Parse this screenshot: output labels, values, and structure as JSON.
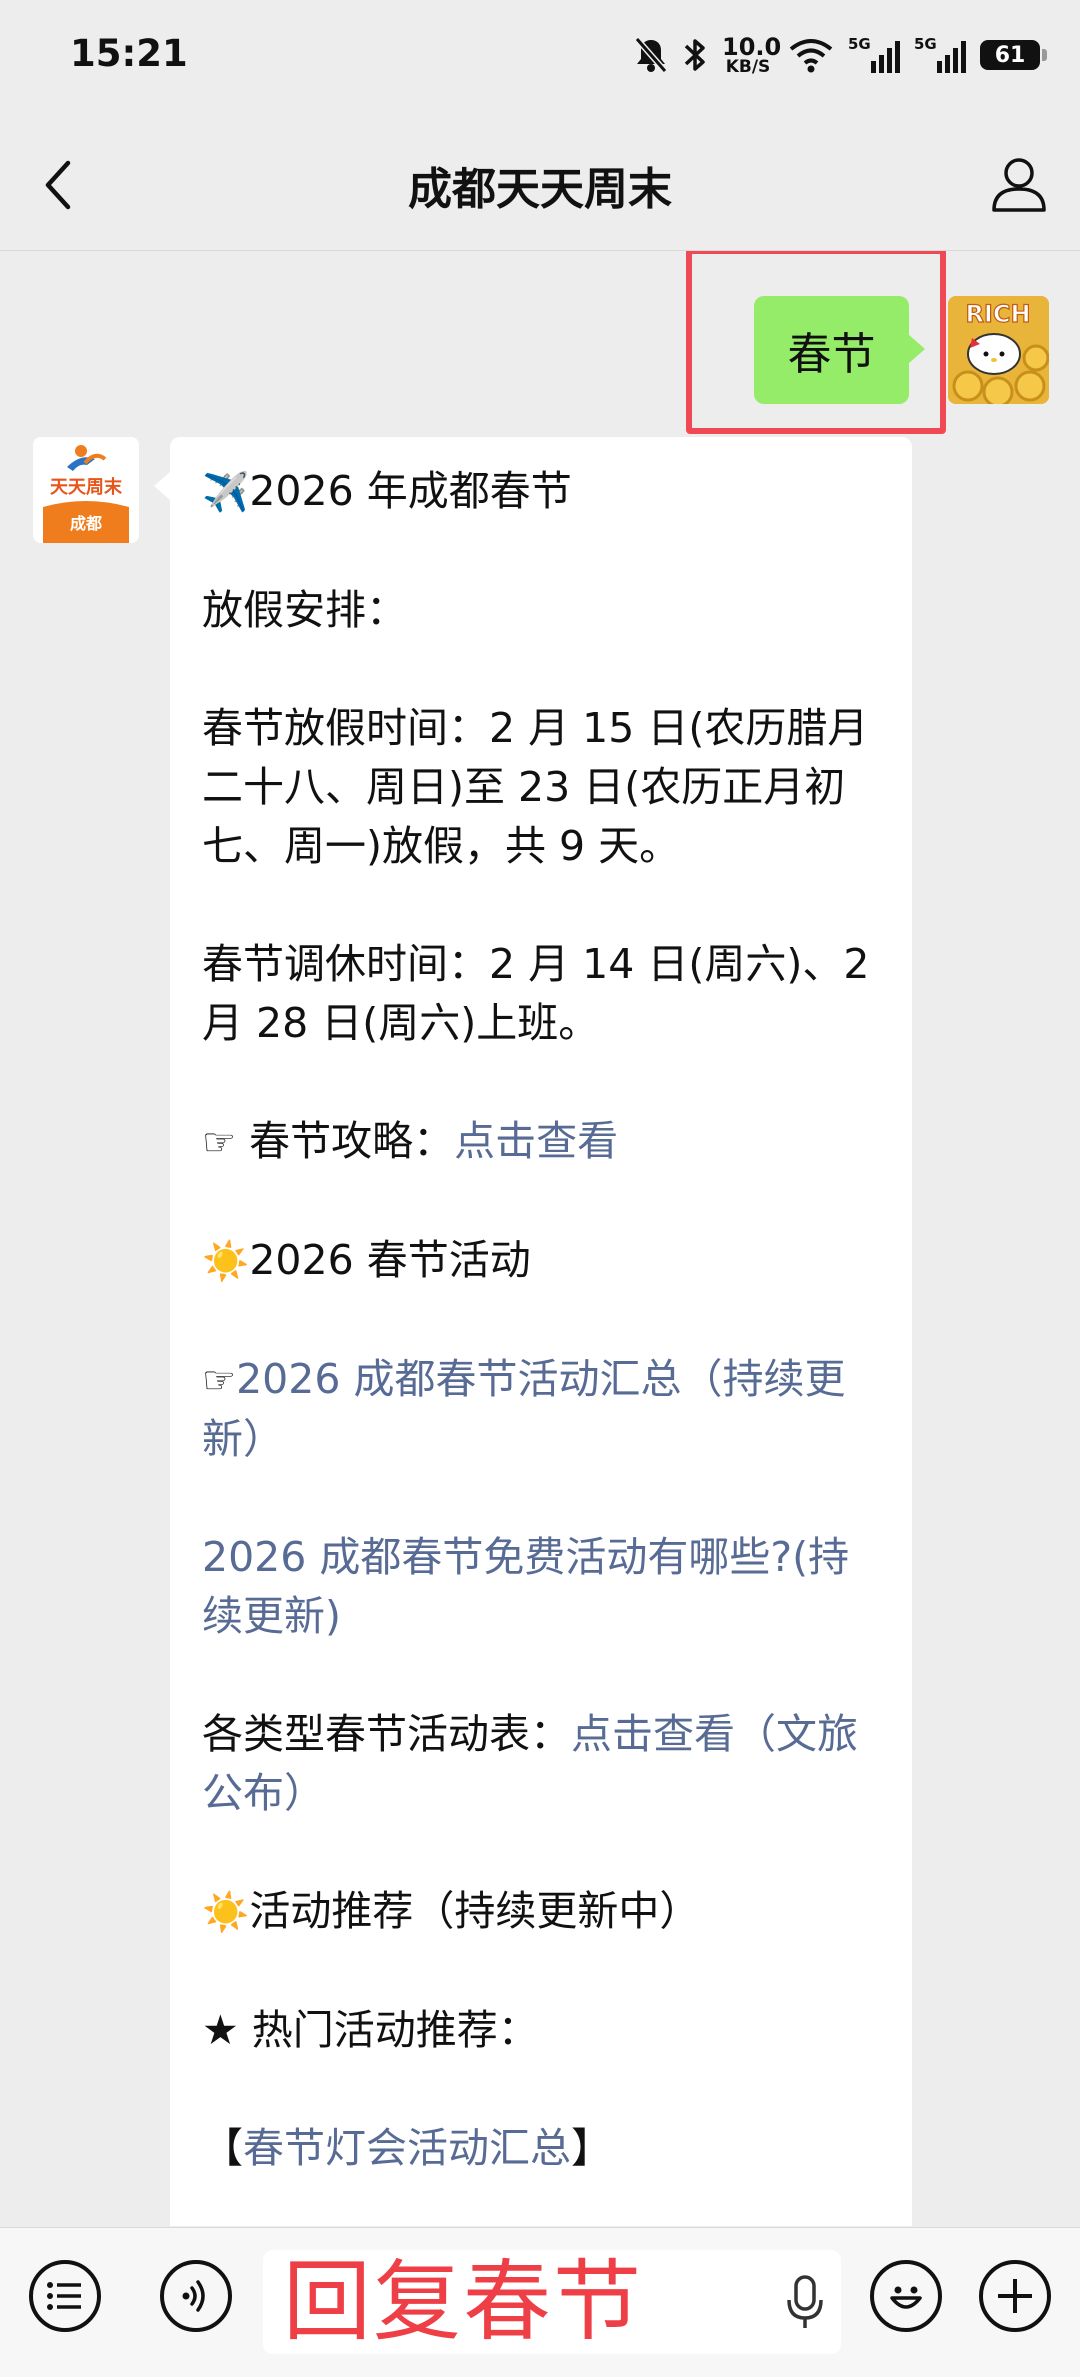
{
  "status_bar": {
    "time": "15:21",
    "net_speed_value": "10.0",
    "net_speed_unit": "KB/S",
    "signal1_label": "5G",
    "signal2_label": "5G",
    "battery": "61"
  },
  "nav": {
    "title": "成都天天周末",
    "back_icon": "chevron-left-icon",
    "profile_icon": "person-icon"
  },
  "sent_message": {
    "text": "春节"
  },
  "my_avatar": {
    "text": "RICH"
  },
  "bot_avatar": {
    "line1": "天天周末",
    "line2": "成都"
  },
  "reply": {
    "title": "2026 年成都春节",
    "holiday_heading": "放假安排：",
    "holiday_time": "春节放假时间：2 月 15 日(农历腊月二十八、周日)至 23 日(农历正月初七、周一)放假，共 9 天。",
    "workday_time": "春节调休时间：2 月 14 日(周六)、2月 28 日(周六)上班。",
    "guide_label": "春节攻略：",
    "guide_link": "点击查看",
    "activities_heading": "2026 春节活动",
    "activities_link1": "2026 成都春节活动汇总（持续更新）",
    "activities_link2": "2026 成都春节免费活动有哪些?(持续更新)",
    "schedule_label": "各类型春节活动表：",
    "schedule_link": "点击查看（文旅公布）",
    "recommend_heading": "活动推荐（持续更新中）",
    "hot_heading": "★ 热门活动推荐：",
    "lantern_open": "【",
    "lantern_link": "春节灯会活动汇总",
    "lantern_close": "】"
  },
  "input_bar": {
    "text": "回复春节",
    "list_icon": "list-icon",
    "voice_icon": "voice-icon",
    "mic_icon": "mic-icon",
    "emoji_icon": "emoji-icon",
    "plus_icon": "plus-icon"
  },
  "colors": {
    "background": "#ededed",
    "sent_bubble": "#95ec69",
    "link": "#576b95",
    "highlight": "#ef4a54"
  }
}
